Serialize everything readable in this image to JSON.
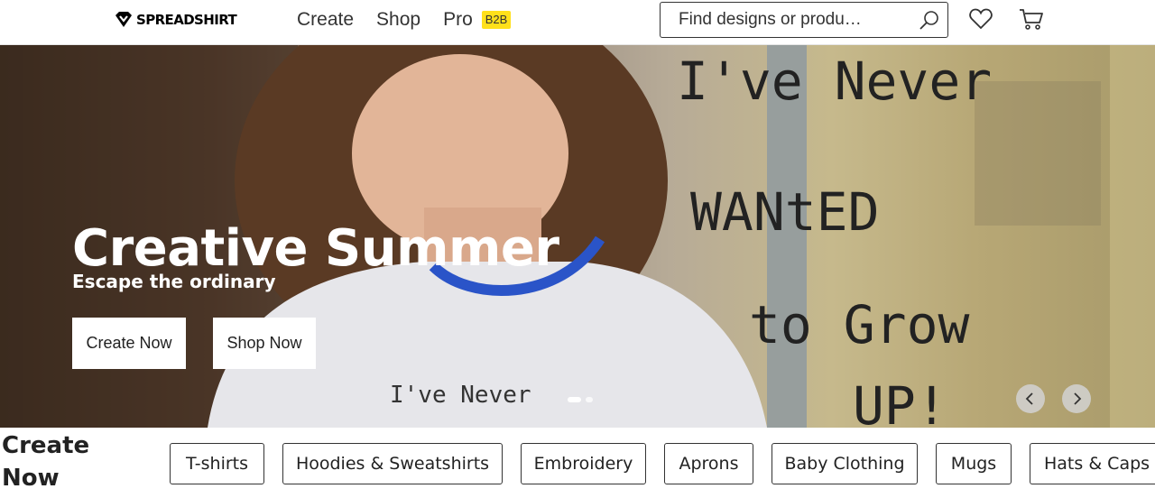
{
  "header": {
    "logo_text": "SPREADSHIRT",
    "nav": [
      "Create",
      "Shop",
      "Pro"
    ],
    "pro_badge": "B2B",
    "search_placeholder": "Find designs or produ…"
  },
  "hero": {
    "title": "Creative Summer",
    "subtitle": "Escape the ordinary",
    "buttons": [
      "Create Now",
      "Shop Now"
    ],
    "slide_count": 2,
    "active_slide": 1,
    "wall_writing": [
      "I've Never",
      "WANtED",
      "to Grow",
      "UP!"
    ],
    "shirt_text": "I've Never"
  },
  "categories": {
    "title": "Create Now",
    "items": [
      "T-shirts",
      "Hoodies & Sweatshirts",
      "Embroidery",
      "Aprons",
      "Baby Clothing",
      "Mugs",
      "Hats & Caps"
    ]
  },
  "colors": {
    "badge": "#ffe01b",
    "text": "#222222"
  },
  "icons": [
    "logo-icon",
    "search-icon",
    "heart-icon",
    "cart-icon",
    "chevron-left-icon",
    "chevron-right-icon"
  ]
}
